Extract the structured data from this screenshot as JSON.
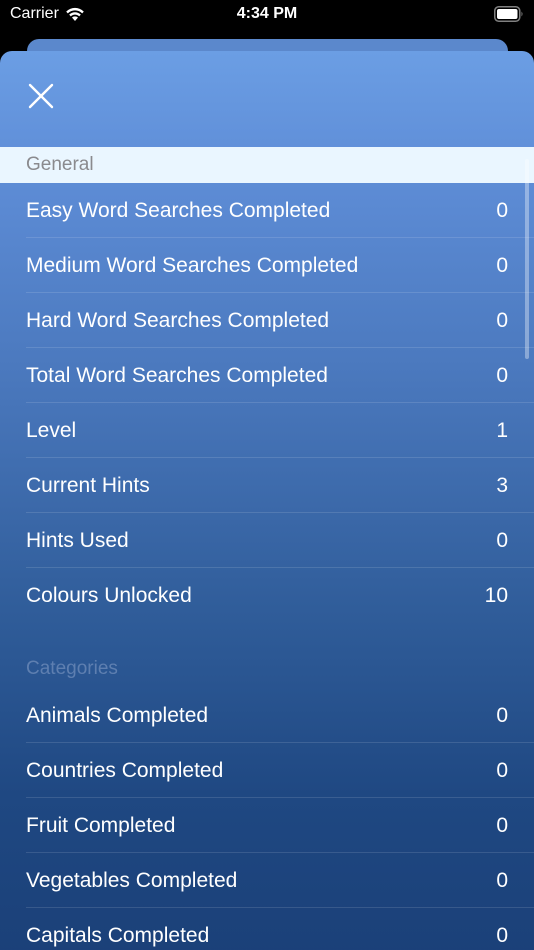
{
  "status_bar": {
    "carrier": "Carrier",
    "time": "4:34 PM"
  },
  "colors": {
    "sheet_top": "#6b9ee4",
    "sheet_bottom": "#1a3f77",
    "general_header_bg": "#eaf6ff",
    "general_header_text": "#8a8a8e",
    "categories_header_text": "#5e7fb0"
  },
  "header": {
    "close_icon": "close-icon"
  },
  "sections": {
    "general": {
      "title": "General",
      "rows": [
        {
          "label": "Easy Word Searches Completed",
          "value": "0"
        },
        {
          "label": "Medium Word Searches Completed",
          "value": "0"
        },
        {
          "label": "Hard Word Searches Completed",
          "value": "0"
        },
        {
          "label": "Total Word Searches Completed",
          "value": "0"
        },
        {
          "label": "Level",
          "value": "1"
        },
        {
          "label": "Current Hints",
          "value": "3"
        },
        {
          "label": "Hints Used",
          "value": "0"
        },
        {
          "label": "Colours Unlocked",
          "value": "10"
        }
      ]
    },
    "categories": {
      "title": "Categories",
      "rows": [
        {
          "label": "Animals Completed",
          "value": "0"
        },
        {
          "label": "Countries Completed",
          "value": "0"
        },
        {
          "label": "Fruit Completed",
          "value": "0"
        },
        {
          "label": "Vegetables Completed",
          "value": "0"
        },
        {
          "label": "Capitals Completed",
          "value": "0"
        }
      ]
    }
  }
}
